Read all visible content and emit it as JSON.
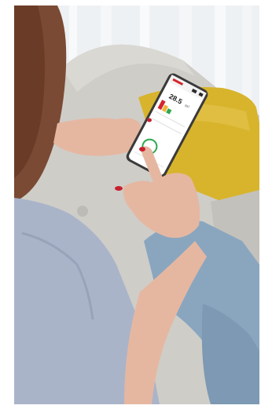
{
  "photo": {
    "scene": "person-using-smartphone-on-sofa",
    "phone_screen": {
      "reading_value": "28.5",
      "unit": "m²"
    }
  },
  "colors": {
    "curtain": "#eef1f3",
    "sofa": "#cfcdc8",
    "cushion": "#d8b42c",
    "hair": "#7b4a34",
    "shirt": "#aab4c9",
    "jeans": "#8aa6bf",
    "skin": "#e5b7a1",
    "nails": "#c8202e",
    "phone_body": "#e7e7e7",
    "accent_red": "#d4262e",
    "accent_green": "#2fa84f"
  }
}
